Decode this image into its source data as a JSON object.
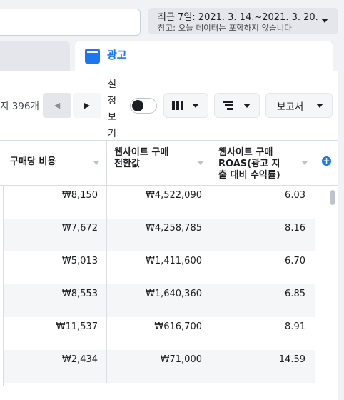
{
  "date_picker": {
    "range": "최근 7일: 2021. 3. 14.~2021. 3. 20.",
    "note": "참고: 오늘 데이터는 포함하지 않습니다"
  },
  "tab": {
    "label": "광고"
  },
  "toolbar": {
    "result_count": "지 396개",
    "settings_label": "설정보기",
    "reports_label": "보고서"
  },
  "table": {
    "headers": [
      {
        "line1": "구매당 비용",
        "line2": "",
        "line3": ""
      },
      {
        "line1": "웹사이트 구매",
        "line2": "전환값",
        "line3": ""
      },
      {
        "line1": "웹사이트 구매",
        "line2": "ROAS(광고 지",
        "line3": "출 대비 수익률)"
      }
    ],
    "rows": [
      {
        "cost": "₩8,150",
        "value": "₩4,522,090",
        "roas": "6.03"
      },
      {
        "cost": "₩7,672",
        "value": "₩4,258,785",
        "roas": "8.16"
      },
      {
        "cost": "₩5,013",
        "value": "₩1,411,600",
        "roas": "6.70"
      },
      {
        "cost": "₩8,553",
        "value": "₩1,640,360",
        "roas": "6.85"
      },
      {
        "cost": "₩11,537",
        "value": "₩616,700",
        "roas": "8.91"
      },
      {
        "cost": "₩2,434",
        "value": "₩71,000",
        "roas": "14.59"
      }
    ]
  }
}
